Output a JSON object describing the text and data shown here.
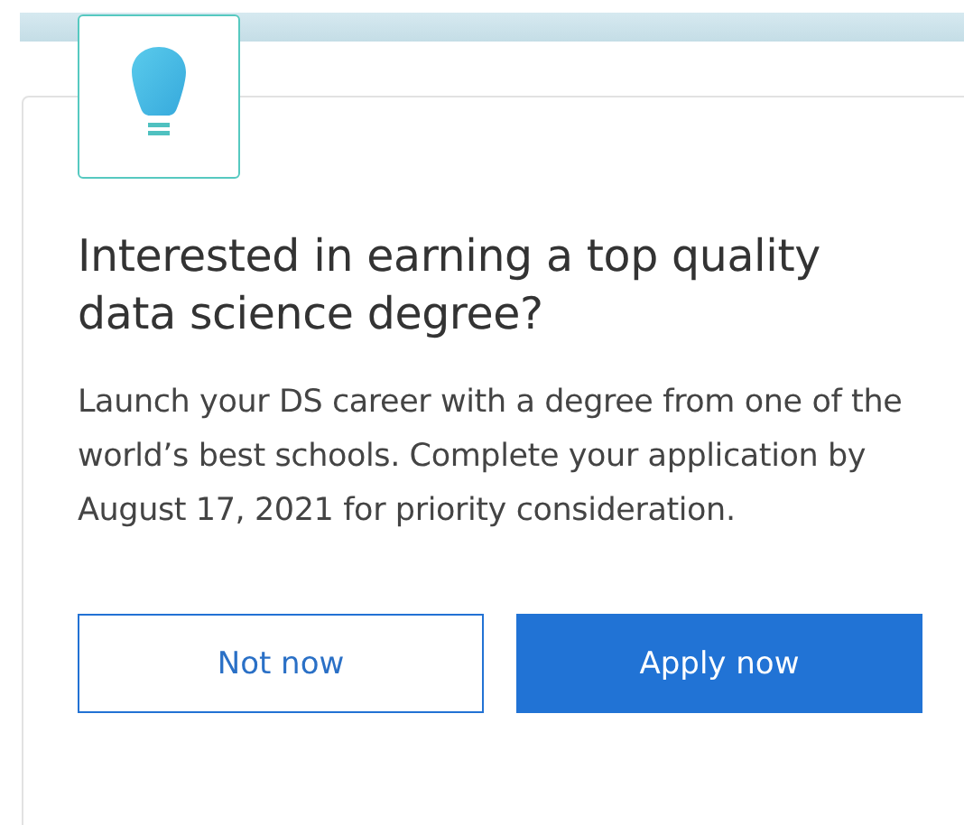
{
  "card": {
    "title": "Interested in earning a top quality data science degree?",
    "body": "Launch your DS career with a degree from one of the world’s best schools. Complete your application by August 17, 2021 for priority consideration.",
    "buttons": [
      {
        "label": "Not now",
        "kind": "secondary"
      },
      {
        "label": "Apply now",
        "kind": "primary"
      }
    ]
  }
}
